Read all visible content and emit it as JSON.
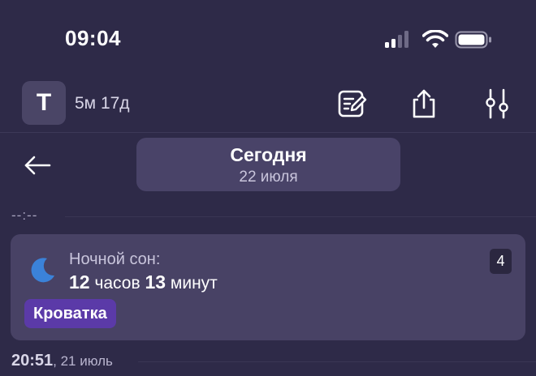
{
  "status_bar": {
    "time": "09:04"
  },
  "header": {
    "avatar_letter": "T",
    "age": "5м 17д"
  },
  "date_nav": {
    "title": "Сегодня",
    "date": "22 июля"
  },
  "timeline": {
    "empty_time": "--:--",
    "entry": {
      "label": "Ночной сон:",
      "hours": "12",
      "hours_unit": "часов",
      "minutes": "13",
      "minutes_unit": "минут",
      "count": "4",
      "tag": "Кроватка",
      "tag_color": "#5b3aa8",
      "icon": "moon-icon",
      "icon_color": "#3b82d9"
    },
    "next_time": "20:51",
    "next_date": ", 21 июль"
  }
}
